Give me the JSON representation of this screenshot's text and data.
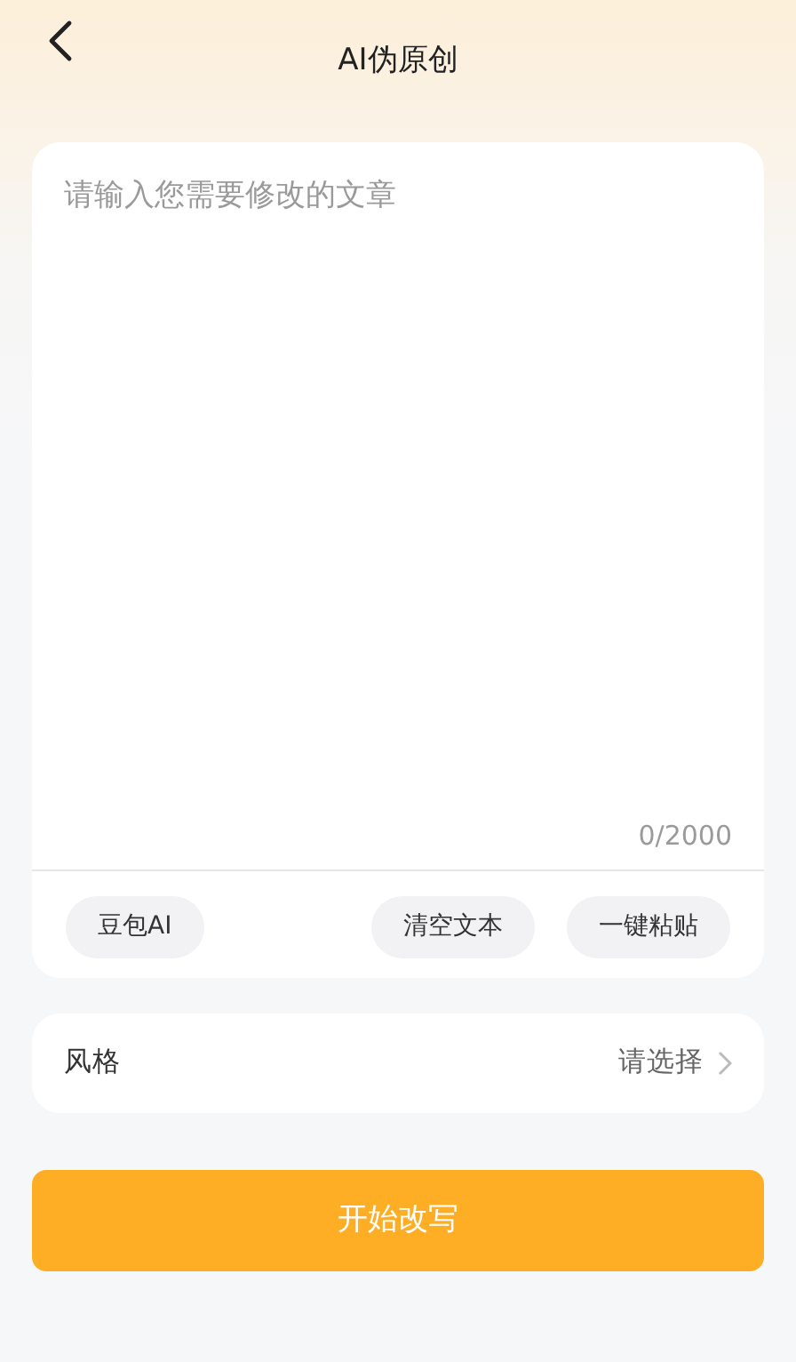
{
  "header": {
    "title": "AI伪原创"
  },
  "editor": {
    "placeholder": "请输入您需要修改的文章",
    "counter": "0/2000",
    "actions": [
      {
        "label": "豆包AI"
      },
      {
        "label": "清空文本"
      },
      {
        "label": "一键粘贴"
      }
    ]
  },
  "style_row": {
    "label": "风格",
    "value": "请选择"
  },
  "submit_button": "开始改写"
}
